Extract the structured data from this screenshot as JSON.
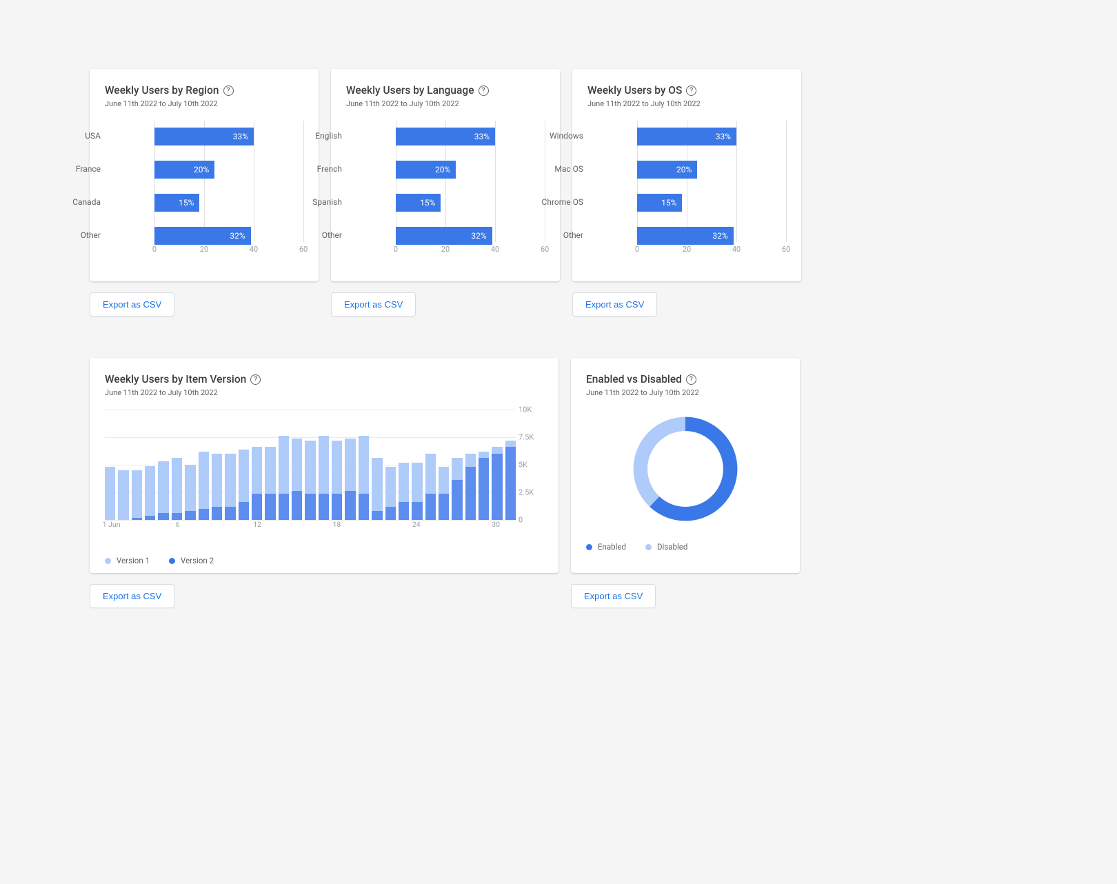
{
  "common": {
    "date_range": "June 11th 2022 to July 10th 2022",
    "export_label": "Export as CSV"
  },
  "cards": {
    "region": {
      "title": "Weekly Users by Region"
    },
    "language": {
      "title": "Weekly Users by Language"
    },
    "os": {
      "title": "Weekly Users by OS"
    },
    "version": {
      "title": "Weekly Users by Item Version"
    },
    "enabled": {
      "title": "Enabled vs Disabled"
    }
  },
  "legend": {
    "version1": "Version 1",
    "version2": "Version 2",
    "enabled": "Enabled",
    "disabled": "Disabled"
  },
  "chart_data": [
    {
      "id": "region",
      "type": "bar",
      "orientation": "horizontal",
      "title": "Weekly Users by Region",
      "categories": [
        "USA",
        "France",
        "Canada",
        "Other"
      ],
      "values": [
        33,
        20,
        15,
        32
      ],
      "value_unit": "%",
      "xlim": [
        0,
        60
      ],
      "xticks": [
        0,
        20,
        40,
        60
      ]
    },
    {
      "id": "language",
      "type": "bar",
      "orientation": "horizontal",
      "title": "Weekly Users by Language",
      "categories": [
        "English",
        "French",
        "Spanish",
        "Other"
      ],
      "values": [
        33,
        20,
        15,
        32
      ],
      "value_unit": "%",
      "xlim": [
        0,
        60
      ],
      "xticks": [
        0,
        20,
        40,
        60
      ]
    },
    {
      "id": "os",
      "type": "bar",
      "orientation": "horizontal",
      "title": "Weekly Users by OS",
      "categories": [
        "Windows",
        "Mac OS",
        "Chrome OS",
        "Other"
      ],
      "values": [
        33,
        20,
        15,
        32
      ],
      "value_unit": "%",
      "xlim": [
        0,
        60
      ],
      "xticks": [
        0,
        20,
        40,
        60
      ]
    },
    {
      "id": "version",
      "type": "bar",
      "orientation": "vertical-stacked",
      "title": "Weekly Users by Item Version",
      "x": [
        1,
        2,
        3,
        4,
        5,
        6,
        7,
        8,
        9,
        10,
        11,
        12,
        13,
        14,
        15,
        16,
        17,
        18,
        19,
        20,
        21,
        22,
        23,
        24,
        25,
        26,
        27,
        28,
        29,
        30,
        31
      ],
      "series": [
        {
          "name": "Version 1",
          "color": "#aecbfa",
          "values": [
            4800,
            4500,
            4300,
            4500,
            4700,
            5000,
            4200,
            5200,
            4800,
            4800,
            4800,
            4200,
            4200,
            5200,
            4800,
            4800,
            5200,
            4800,
            4800,
            5200,
            4800,
            3600,
            3600,
            3600,
            3600,
            2400,
            2000,
            1200,
            600,
            600,
            600
          ]
        },
        {
          "name": "Version 2",
          "color": "#5c8def",
          "values": [
            0,
            0,
            200,
            400,
            600,
            600,
            800,
            1000,
            1200,
            1200,
            1600,
            2400,
            2400,
            2400,
            2600,
            2400,
            2400,
            2400,
            2600,
            2400,
            800,
            1200,
            1600,
            1600,
            2400,
            2400,
            3600,
            4800,
            5600,
            6000,
            6600
          ]
        }
      ],
      "ylim": [
        0,
        10000
      ],
      "yticks": [
        0,
        2500,
        5000,
        7500,
        10000
      ],
      "ytick_labels": [
        "0",
        "2.5K",
        "5K",
        "7.5K",
        "10K"
      ],
      "xtick_labels": [
        {
          "index": 0,
          "label": "1 Jun"
        },
        {
          "index": 5,
          "label": "6"
        },
        {
          "index": 11,
          "label": "12"
        },
        {
          "index": 17,
          "label": "18"
        },
        {
          "index": 23,
          "label": "24"
        },
        {
          "index": 29,
          "label": "30"
        }
      ]
    },
    {
      "id": "enabled",
      "type": "donut",
      "title": "Enabled vs Disabled",
      "series": [
        {
          "name": "Enabled",
          "value": 62,
          "color": "#3b78e7"
        },
        {
          "name": "Disabled",
          "value": 38,
          "color": "#aecbfa"
        }
      ]
    }
  ]
}
